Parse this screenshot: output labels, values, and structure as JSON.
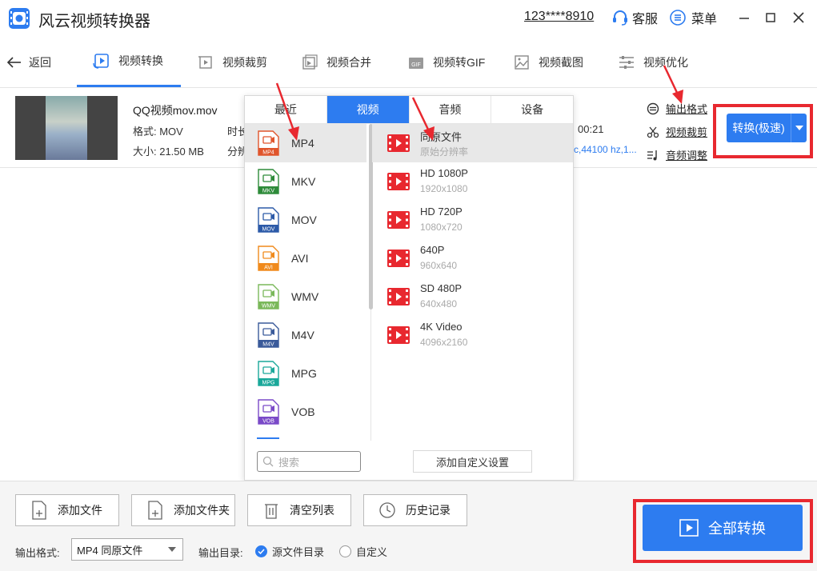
{
  "app": {
    "title": "风云视频转换器",
    "user_id": "123****8910",
    "service_label": "客服",
    "menu_label": "菜单"
  },
  "nav": {
    "back_label": "返回",
    "tabs": [
      {
        "label": "视频转换",
        "active": true
      },
      {
        "label": "视频裁剪"
      },
      {
        "label": "视频合并"
      },
      {
        "label": "视频转GIF"
      },
      {
        "label": "视频截图"
      },
      {
        "label": "视频优化"
      }
    ]
  },
  "file": {
    "name": "QQ视频mov.mov",
    "format": "格式: MOV",
    "size": "大小: 21.50 MB",
    "duration_label": "时长",
    "resolution_label": "分辨",
    "duration_tail": "00:21",
    "audio_tail": "c,44100 hz,1...",
    "links": [
      "输出格式",
      "视频裁剪",
      "音频调整"
    ],
    "convert_label": "转换(极速)"
  },
  "panel": {
    "tabs": [
      {
        "label": "最近"
      },
      {
        "label": "视频",
        "active": true
      },
      {
        "label": "音频"
      },
      {
        "label": "设备"
      }
    ],
    "formats": [
      {
        "name": "MP4",
        "color": "#e0552c",
        "active": true
      },
      {
        "name": "MKV",
        "color": "#2e8b3a"
      },
      {
        "name": "MOV",
        "color": "#2c5aa8"
      },
      {
        "name": "AVI",
        "color": "#f08a1c"
      },
      {
        "name": "WMV",
        "color": "#7ab85a"
      },
      {
        "name": "M4V",
        "color": "#3a5a9a"
      },
      {
        "name": "MPG",
        "color": "#1aa89a"
      },
      {
        "name": "VOB",
        "color": "#7a4ac8"
      }
    ],
    "resolutions": [
      {
        "name": "同原文件",
        "dim": "原始分辨率",
        "active": true
      },
      {
        "name": "HD 1080P",
        "dim": "1920x1080"
      },
      {
        "name": "HD 720P",
        "dim": "1080x720"
      },
      {
        "name": "640P",
        "dim": "960x640"
      },
      {
        "name": "SD 480P",
        "dim": "640x480"
      },
      {
        "name": "4K Video",
        "dim": "4096x2160"
      }
    ],
    "search_placeholder": "搜索",
    "add_custom_label": "添加自定义设置"
  },
  "bottom": {
    "buttons": [
      "添加文件",
      "添加文件夹",
      "清空列表",
      "历史记录"
    ],
    "output_format_label": "输出格式:",
    "output_format_value": "MP4 同原文件",
    "output_dir_label": "输出目录:",
    "dir_options": [
      {
        "label": "源文件目录",
        "checked": true
      },
      {
        "label": "自定义",
        "checked": false
      }
    ],
    "convert_all_label": "全部转换"
  },
  "colors": {
    "accent": "#2d7cf0",
    "highlight_red": "#e8282f"
  }
}
